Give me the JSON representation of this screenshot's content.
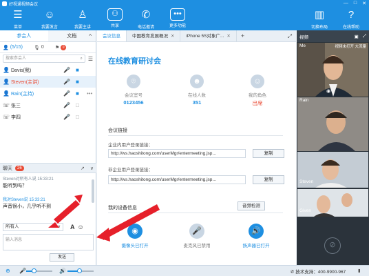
{
  "window": {
    "title": "好视通视频会议"
  },
  "toolbar": {
    "items": [
      {
        "label": "菜单",
        "icon": "menu-icon"
      },
      {
        "label": "我要发言",
        "icon": "speaker-icon"
      },
      {
        "label": "我要主讲",
        "icon": "presenter-icon"
      },
      {
        "label": "共享",
        "icon": "share-icon"
      },
      {
        "label": "电话邀请",
        "icon": "phone-icon"
      },
      {
        "label": "更多功能",
        "icon": "more-icon"
      },
      {
        "label": "切换布局",
        "icon": "layout-icon"
      },
      {
        "label": "在线帮助",
        "icon": "help-icon"
      }
    ]
  },
  "left_panel": {
    "tabs": [
      "参会人",
      "文档"
    ],
    "counts": {
      "people": "(5/15)",
      "mic": "0",
      "hand": "0"
    },
    "search_placeholder": "搜索参会人",
    "participants": [
      {
        "name": "Davis(我)",
        "role": "self"
      },
      {
        "name": "Steven(主讲)",
        "role": "host"
      },
      {
        "name": "Rain(主持)",
        "role": "chair"
      },
      {
        "name": "张三",
        "role": "phone"
      },
      {
        "name": "李四",
        "role": "phone"
      }
    ]
  },
  "chat": {
    "title": "聊天",
    "badge": "26",
    "messages": [
      {
        "meta": "Steven对所有人说  15:33:21",
        "text": "能听到吗？",
        "meta_color": "gray"
      },
      {
        "meta": "我对Steven说  15:33:21",
        "text": "声音很小，几乎听不到",
        "meta_color": "blue"
      }
    ],
    "recipient": "所有人",
    "input_placeholder": "输入消息",
    "send_label": "发送"
  },
  "center": {
    "tabs": [
      {
        "label": "会议信息",
        "active": true
      },
      {
        "label": "中国教育发展概况",
        "active": false
      },
      {
        "label": "iPhone 5S对象广...",
        "active": false
      }
    ],
    "meeting_title": "在线教育研讨会",
    "stats": [
      {
        "label": "会议室号",
        "value": "0123456"
      },
      {
        "label": "在线人数",
        "value": "351"
      },
      {
        "label": "我的角色",
        "value": "出席"
      }
    ],
    "link_section": "会议链接",
    "internal_label": "企业内用户登录链接：",
    "internal_link": "http://ws.haoshitong.com/userMgr/entermeeting.jsp...",
    "external_label": "非企业用户登录链接：",
    "external_link": "http://ws.haoshitong.com/userMgr/entermeeting.jsp...",
    "copy_label": "复制",
    "device_section": "我的设备信息",
    "sound_check": "音频检测",
    "devices": [
      {
        "label": "摄像头已打开",
        "icon": "camera-icon",
        "color": "#1e8fe1"
      },
      {
        "label": "麦克风已禁用",
        "icon": "mic-icon",
        "color": "#c9d6e3"
      },
      {
        "label": "扬声器已打开",
        "icon": "speaker-icon",
        "color": "#1e8fe1"
      }
    ]
  },
  "video_panel": {
    "title": "视频",
    "tiles": [
      {
        "name": "Me",
        "info": "视频未打开 大流量"
      },
      {
        "name": "Rain",
        "info": ""
      },
      {
        "name": "Steven",
        "info": ""
      },
      {
        "name": "Given",
        "info": ""
      }
    ]
  },
  "statusbar": {
    "support": "技术支持：400-9900-967"
  },
  "colors": {
    "brand": "#1e8fe1",
    "accent": "#e94b35"
  }
}
